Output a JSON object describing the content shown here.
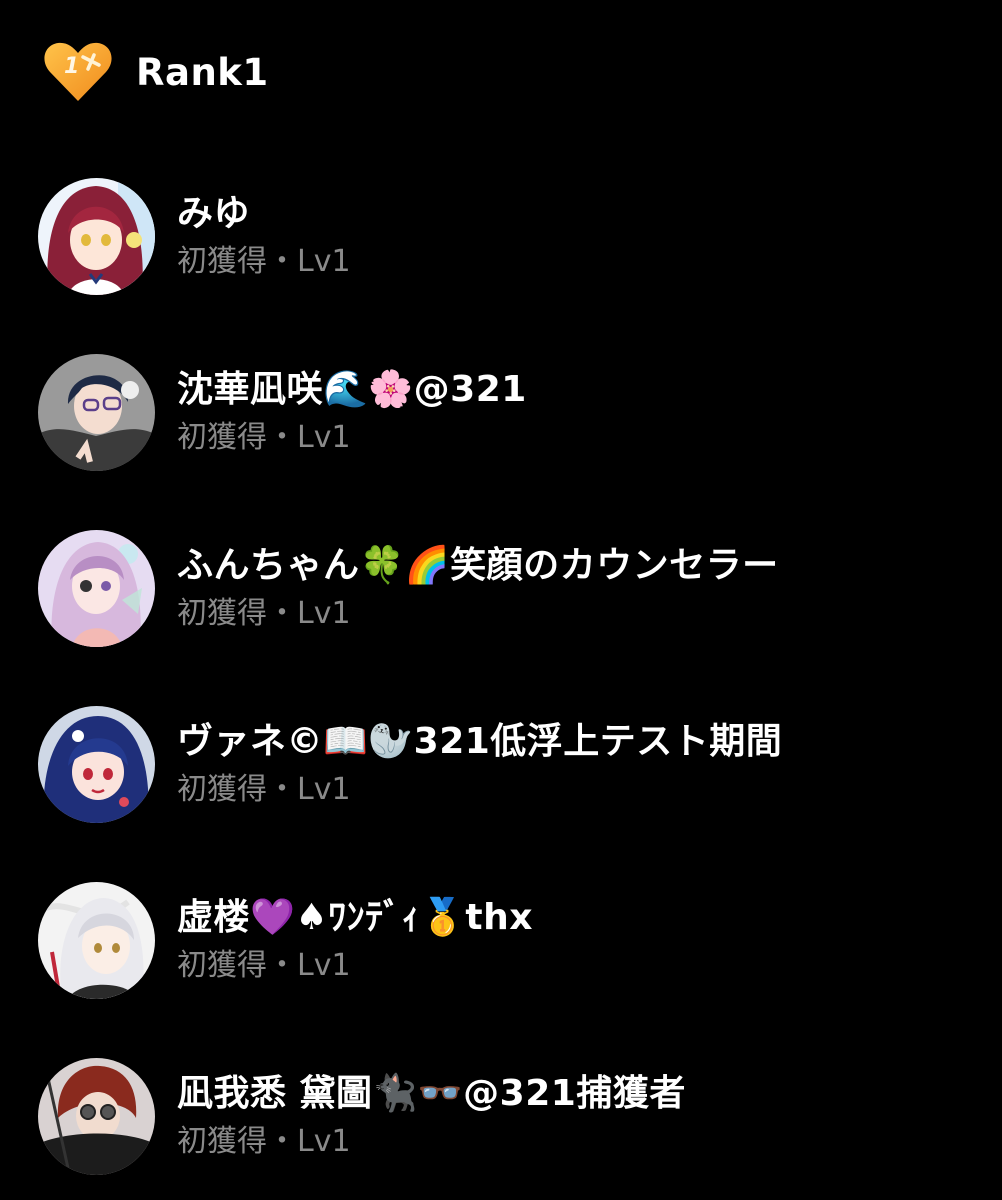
{
  "header": {
    "badge_icon": "rank-1-heart-icon",
    "badge_text": "1",
    "title": "Rank1"
  },
  "colors": {
    "background": "#000000",
    "name": "#ffffff",
    "subtext": "#8a8a8a",
    "badge_orange": "#f5a623"
  },
  "users": [
    {
      "name": "みゆ",
      "sub": "初獲得・Lv1",
      "avatar": "anime-girl-red-hair-avatar"
    },
    {
      "name": "沈華凪咲🌊🌸@321",
      "sub": "初獲得・Lv1",
      "avatar": "anime-boy-dark-hair-glasses-avatar"
    },
    {
      "name": "ふんちゃん🍀🌈笑顔のカウンセラー",
      "sub": "初獲得・Lv1",
      "avatar": "anime-pink-hair-eyepatch-avatar"
    },
    {
      "name": "ヴァネ©📖🦭321低浮上テスト期間",
      "sub": "初獲得・Lv1",
      "avatar": "anime-girl-navy-hair-avatar"
    },
    {
      "name": "虚楼💜♠ﾜﾝﾃﾞｨ🥇thx",
      "sub": "初獲得・Lv1",
      "avatar": "anime-white-hair-avatar"
    },
    {
      "name": "凪我悉 黛圖🐈‍⬛👓@321捕獲者",
      "sub": "初獲得・Lv1",
      "avatar": "anime-red-hair-goggles-avatar"
    }
  ]
}
